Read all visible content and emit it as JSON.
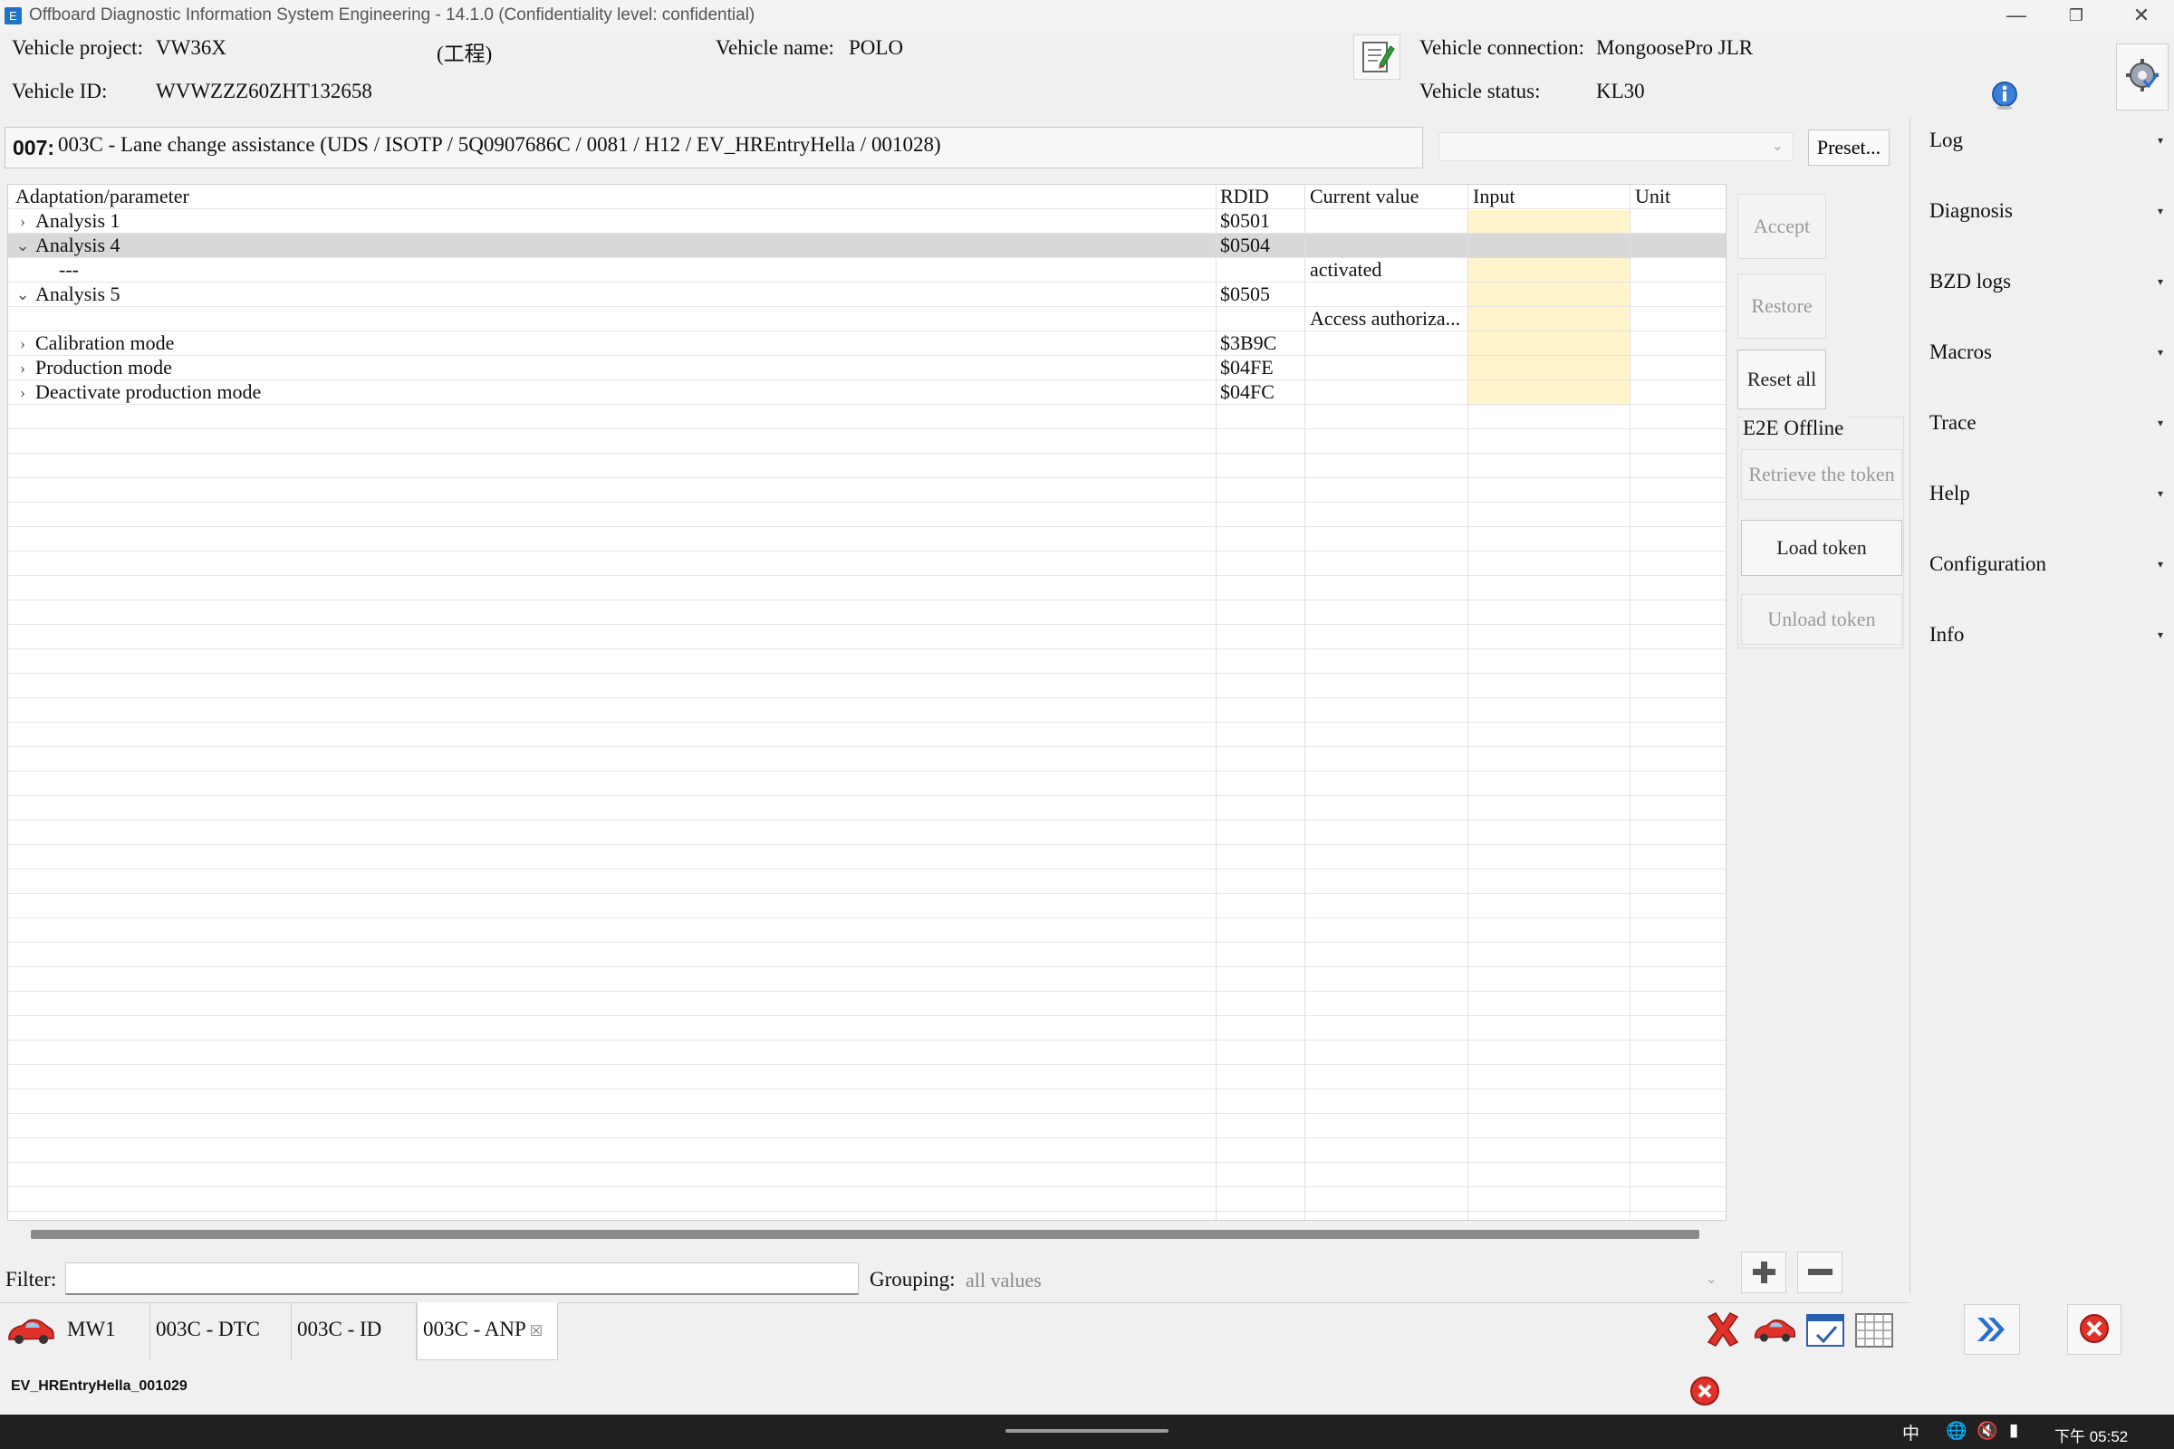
{
  "window": {
    "title": "Offboard Diagnostic Information System Engineering - 14.1.0 (Confidentiality level: confidential)",
    "controls": [
      "minimize-icon",
      "restore-icon",
      "close-icon"
    ]
  },
  "header": {
    "vehicle_project_label": "Vehicle project:",
    "vehicle_project_value": "VW36X",
    "mode_value": "(工程)",
    "vehicle_name_label": "Vehicle name:",
    "vehicle_name_value": "POLO",
    "vehicle_id_label": "Vehicle ID:",
    "vehicle_id_value": "WVWZZZ60ZHT132658",
    "vehicle_connection_label": "Vehicle connection:",
    "vehicle_connection_value": "MongoosePro JLR",
    "vehicle_status_label": "Vehicle status:",
    "vehicle_status_value": "KL30"
  },
  "ecu": {
    "number": "007:",
    "description": "003C - Lane change assistance  (UDS / ISOTP / 5Q0907686C / 0081 / H12 / EV_HREntryHella / 001028)",
    "preset_label": "Preset..."
  },
  "table": {
    "columns": [
      "Adaptation/parameter",
      "RDID",
      "Current value",
      "Input",
      "Unit"
    ],
    "rows": [
      {
        "expander": "›",
        "param": "Analysis 1",
        "rdid": "$0501",
        "current": "",
        "indent": 0,
        "selected": false
      },
      {
        "expander": "⌄",
        "param": "Analysis 4",
        "rdid": "$0504",
        "current": "",
        "indent": 0,
        "selected": true
      },
      {
        "expander": "",
        "param": "---",
        "rdid": "",
        "current": "activated",
        "indent": 1,
        "selected": false
      },
      {
        "expander": "⌄",
        "param": "Analysis 5",
        "rdid": "$0505",
        "current": "",
        "indent": 0,
        "selected": false
      },
      {
        "expander": "",
        "param": "",
        "rdid": "",
        "current": "Access authoriza...",
        "indent": 1,
        "selected": false
      },
      {
        "expander": "›",
        "param": "Calibration mode",
        "rdid": "$3B9C",
        "current": "",
        "indent": 0,
        "selected": false
      },
      {
        "expander": "›",
        "param": "Production mode",
        "rdid": "$04FE",
        "current": "",
        "indent": 0,
        "selected": false
      },
      {
        "expander": "›",
        "param": "Deactivate production mode",
        "rdid": "$04FC",
        "current": "",
        "indent": 0,
        "selected": false
      }
    ]
  },
  "actions": {
    "accept": "Accept",
    "restore": "Restore",
    "reset_all": "Reset all",
    "e2e_label": "E2E Offline",
    "retrieve_token": "Retrieve the token",
    "load_token": "Load token",
    "unload_token": "Unload token"
  },
  "side_panel": {
    "items": [
      "Log",
      "Diagnosis",
      "BZD logs",
      "Macros",
      "Trace",
      "Help",
      "Configuration",
      "Info"
    ]
  },
  "filter": {
    "label": "Filter:",
    "value": "",
    "grouping_label": "Grouping:",
    "grouping_value": "all values"
  },
  "tabs": [
    {
      "label": "MW1",
      "active": false
    },
    {
      "label": "003C - DTC",
      "active": false
    },
    {
      "label": "003C - ID",
      "active": false
    },
    {
      "label": "003C - ANP",
      "active": true
    }
  ],
  "status": {
    "text": "EV_HREntryHella_001029"
  },
  "taskbar": {
    "ime": "中",
    "time": "下午 05:52"
  },
  "colors": {
    "input_cell": "#fff4cc",
    "selected_row": "#d8d8d8",
    "error_red": "#e0322a",
    "accent_blue": "#1e73c8"
  }
}
